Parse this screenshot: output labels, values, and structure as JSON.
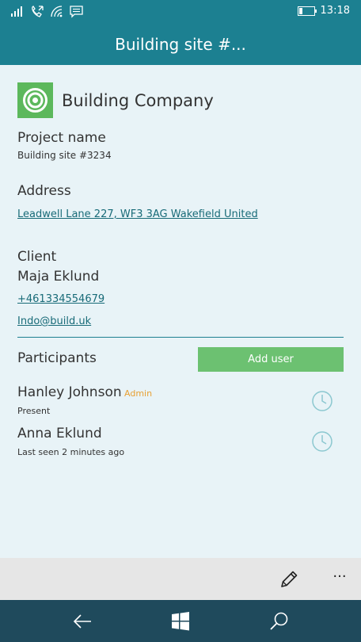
{
  "status_bar": {
    "time": "13:18",
    "icons": [
      "signal-icon",
      "call-forwarding-icon",
      "wifi-icon",
      "message-icon",
      "battery-icon"
    ]
  },
  "header": {
    "title": "Building site #..."
  },
  "company": {
    "name": "Building Company",
    "logo_color": "#5cb85c"
  },
  "project": {
    "label": "Project name",
    "value": "Building site #3234"
  },
  "address": {
    "label": "Address",
    "value": "Leadwell Lane 227, WF3 3AG Wakefield United"
  },
  "client": {
    "label": "Client",
    "name": "Maja Eklund",
    "phone": "+461334554679",
    "email": "Indo@build.uk"
  },
  "participants": {
    "label": "Participants",
    "add_button": "Add user",
    "list": [
      {
        "name": "Hanley Johnson",
        "badge": "Admin",
        "status": "Present"
      },
      {
        "name": "Anna Eklund",
        "badge": "",
        "status": "Last seen 2 minutes ago"
      }
    ]
  },
  "app_bar": {
    "more": "···"
  },
  "colors": {
    "header": "#1c8091",
    "background": "#e8f3f7",
    "accent_button": "#6cc171",
    "admin_badge": "#e8a033",
    "nav_bar": "#1f4a5c"
  }
}
